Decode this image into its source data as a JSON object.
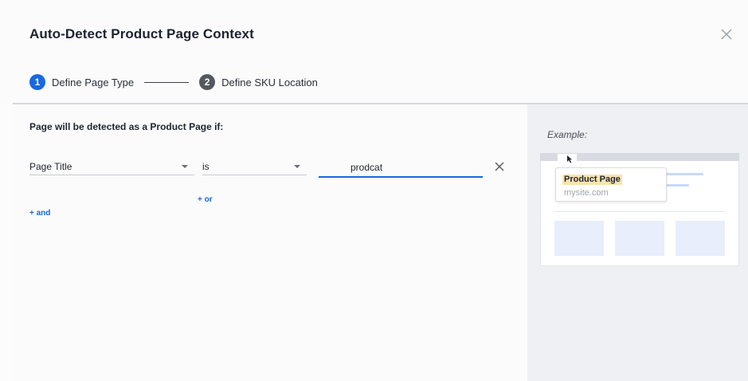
{
  "dialog": {
    "title": "Auto-Detect Product Page Context",
    "close_icon": "close-icon"
  },
  "stepper": {
    "steps": [
      {
        "number": "1",
        "label": "Define Page Type",
        "state": "active"
      },
      {
        "number": "2",
        "label": "Define SKU Location",
        "state": "inactive"
      }
    ]
  },
  "rules": {
    "heading": "Page will be detected as a Product Page if:",
    "condition": {
      "field": "Page Title",
      "operator": "is",
      "value": "prodcat"
    },
    "add_or": "+ or",
    "add_and": "+ and"
  },
  "example": {
    "label": "Example:",
    "tooltip_title": "Product Page",
    "tooltip_url": "mysite.com"
  },
  "colors": {
    "accent": "#1868e0",
    "highlight": "#fbe3ae",
    "inactive_step": "#55585e"
  }
}
